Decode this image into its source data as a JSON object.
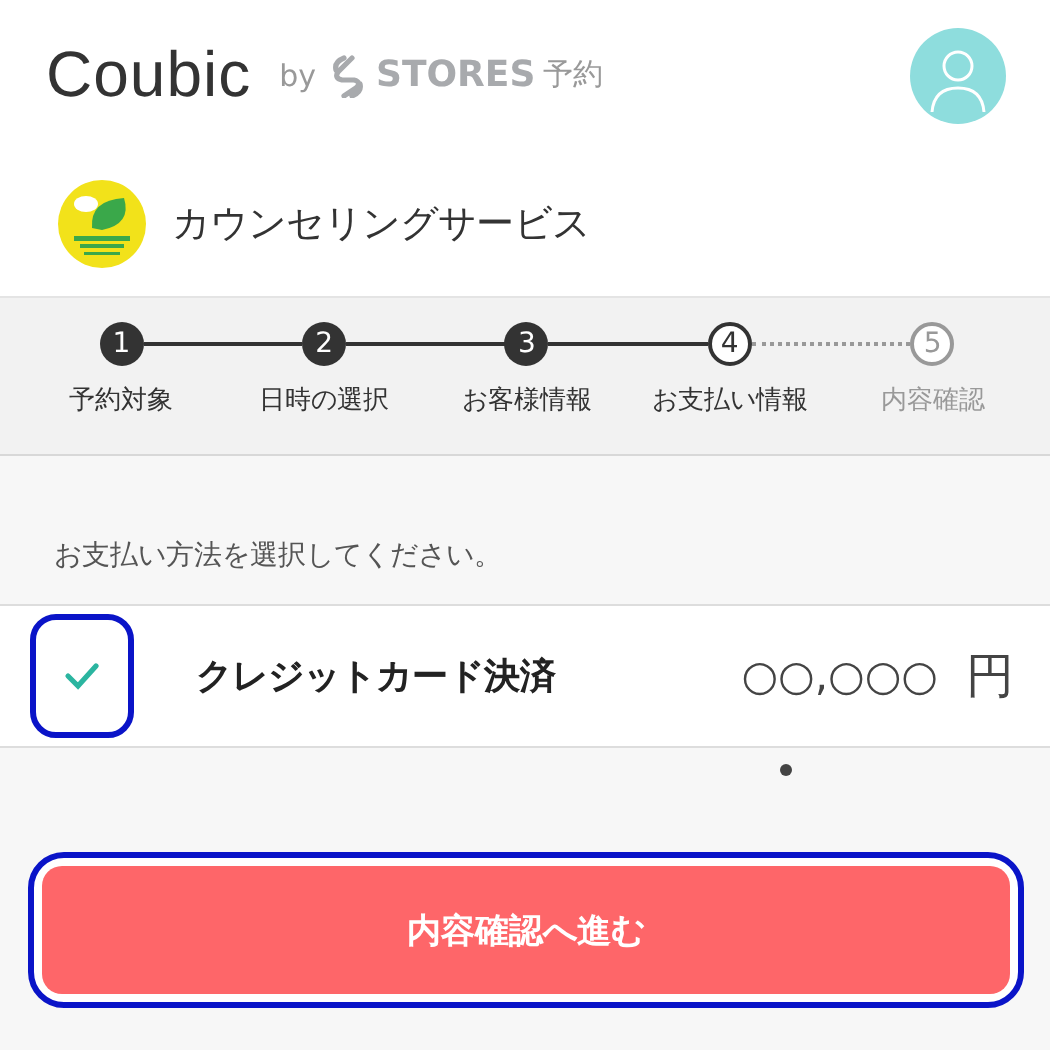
{
  "header": {
    "brand": "Coubic",
    "by": "by",
    "partner": "STORES",
    "partner_suffix": "予約"
  },
  "shop": {
    "name": "カウンセリングサービス"
  },
  "steps": [
    {
      "number": "1",
      "label": "予約対象",
      "kind": "done"
    },
    {
      "number": "2",
      "label": "日時の選択",
      "kind": "done"
    },
    {
      "number": "3",
      "label": "お客様情報",
      "kind": "done"
    },
    {
      "number": "4",
      "label": "お支払い情報",
      "kind": "current"
    },
    {
      "number": "5",
      "label": "内容確認",
      "kind": "upcoming"
    }
  ],
  "instruction": "お支払い方法を選択してください。",
  "payment": {
    "checked": true,
    "label": "クレジットカード決済",
    "amount": "○○,○○○",
    "currency": "円"
  },
  "next_button": "内容確認へ進む"
}
